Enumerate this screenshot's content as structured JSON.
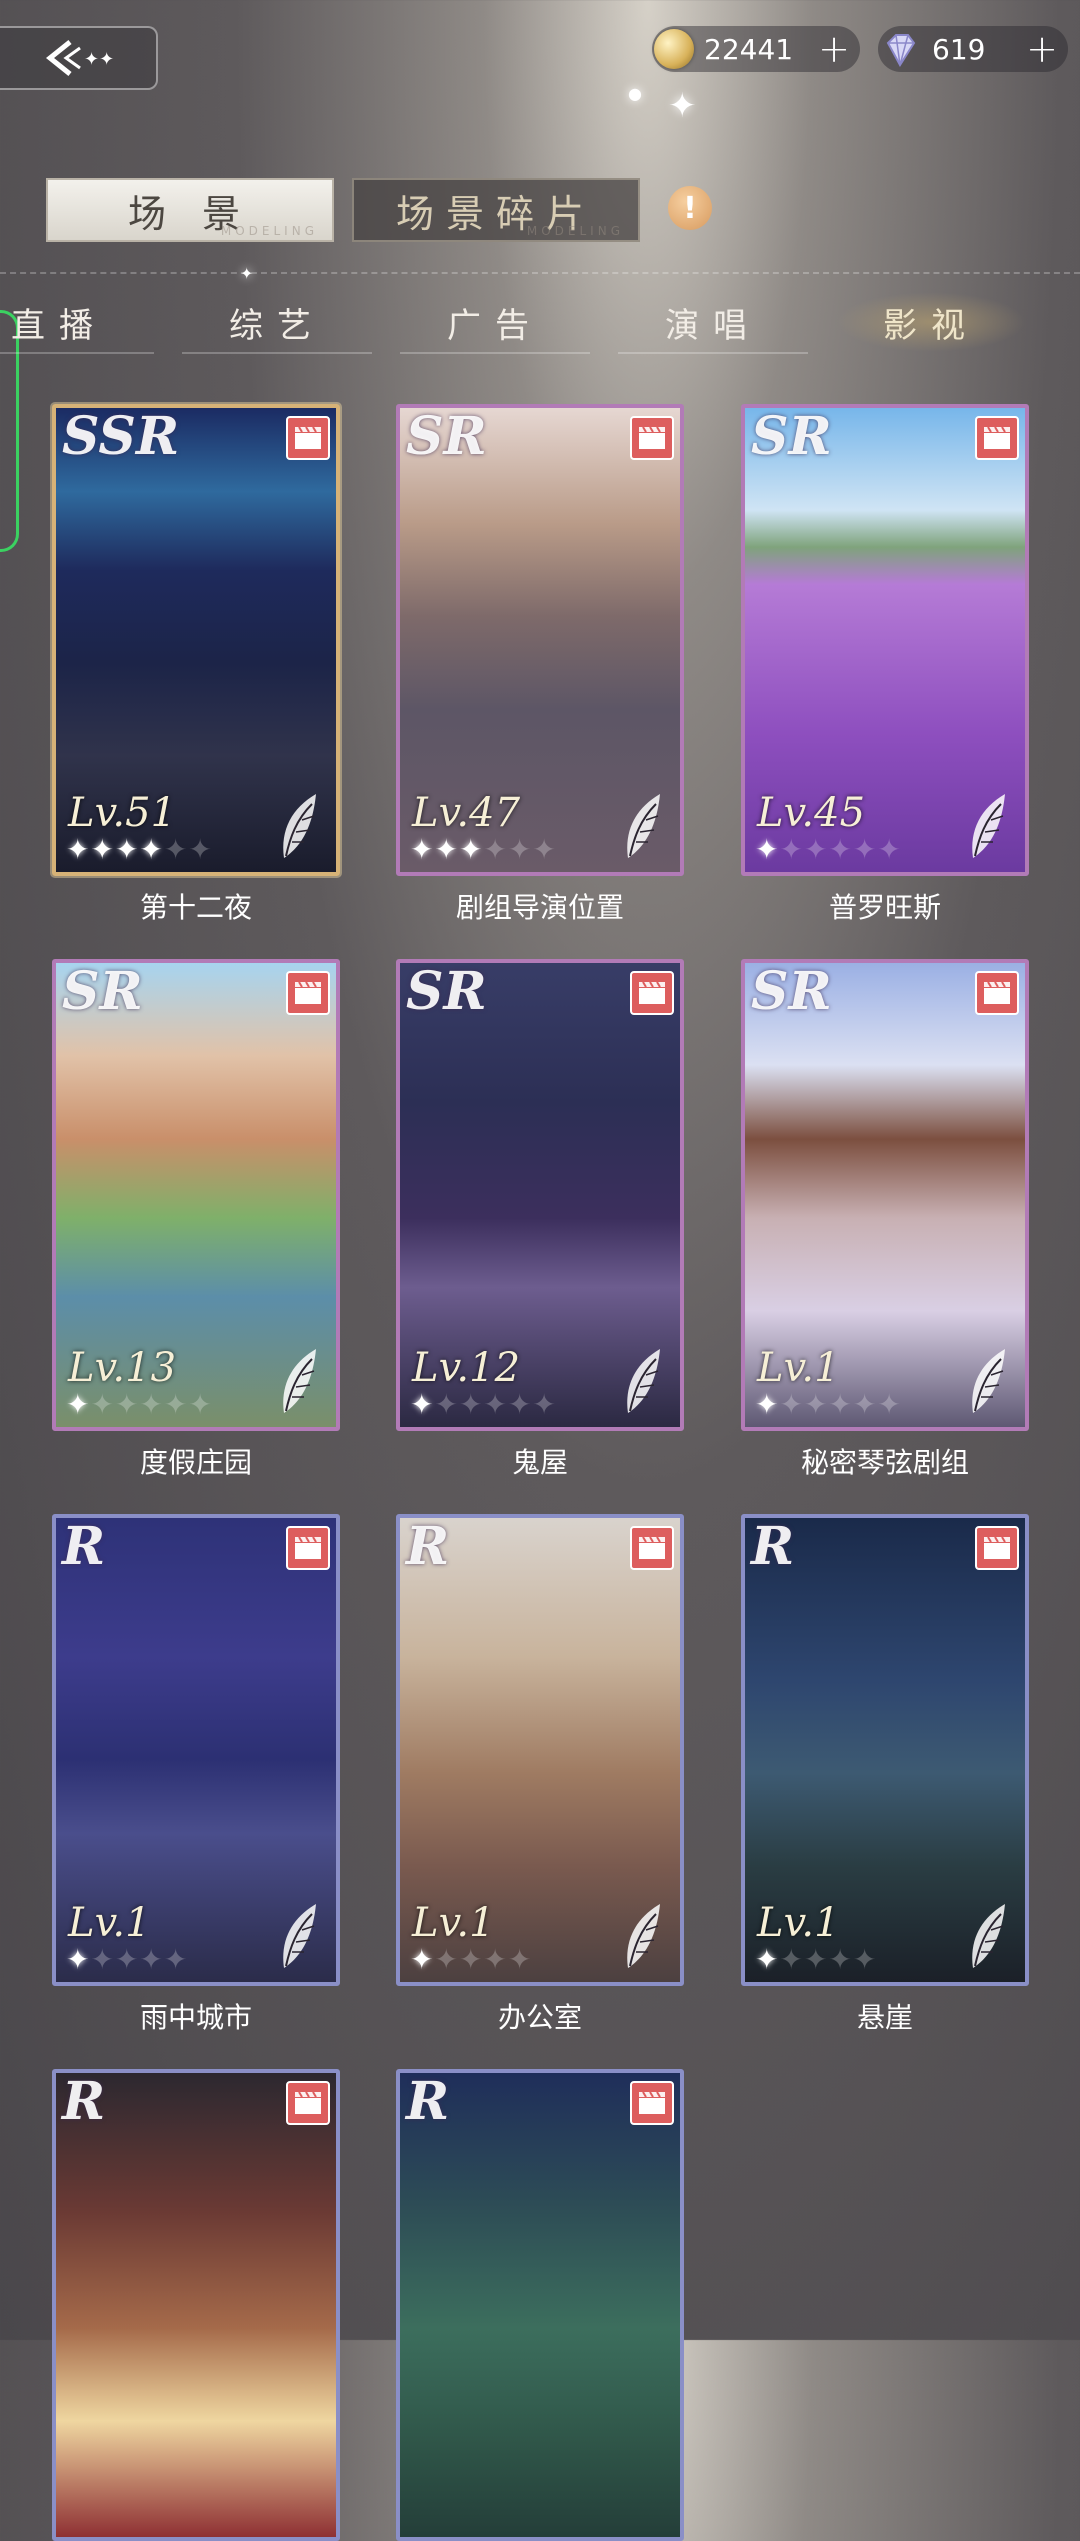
{
  "top_bar": {
    "coins": "22441",
    "gems": "619",
    "plus": "+"
  },
  "mode_tabs": [
    {
      "label": "场 景",
      "sub": "MODELING",
      "active": true
    },
    {
      "label": "场景碎片",
      "sub": "MODELING",
      "active": false
    }
  ],
  "info_badge": "!",
  "categories": [
    {
      "label": "直播",
      "active": false
    },
    {
      "label": "综艺",
      "active": false
    },
    {
      "label": "广告",
      "active": false
    },
    {
      "label": "演唱",
      "active": false
    },
    {
      "label": "影视",
      "active": true
    }
  ],
  "cards": [
    {
      "name": "第十二夜",
      "rarity": "SSR",
      "level": "Lv.51",
      "stars_on": 4,
      "stars_total": 6
    },
    {
      "name": "剧组导演位置",
      "rarity": "SR",
      "level": "Lv.47",
      "stars_on": 3,
      "stars_total": 6
    },
    {
      "name": "普罗旺斯",
      "rarity": "SR",
      "level": "Lv.45",
      "stars_on": 1,
      "stars_total": 6
    },
    {
      "name": "度假庄园",
      "rarity": "SR",
      "level": "Lv.13",
      "stars_on": 1,
      "stars_total": 6
    },
    {
      "name": "鬼屋",
      "rarity": "SR",
      "level": "Lv.12",
      "stars_on": 1,
      "stars_total": 6
    },
    {
      "name": "秘密琴弦剧组",
      "rarity": "SR",
      "level": "Lv.1",
      "stars_on": 1,
      "stars_total": 6
    },
    {
      "name": "雨中城市",
      "rarity": "R",
      "level": "Lv.1",
      "stars_on": 1,
      "stars_total": 5
    },
    {
      "name": "办公室",
      "rarity": "R",
      "level": "Lv.1",
      "stars_on": 1,
      "stars_total": 5
    },
    {
      "name": "悬崖",
      "rarity": "R",
      "level": "Lv.1",
      "stars_on": 1,
      "stars_total": 5
    },
    {
      "name": "",
      "rarity": "R",
      "level": "",
      "stars_on": 0,
      "stars_total": 0
    },
    {
      "name": "",
      "rarity": "R",
      "level": "",
      "stars_on": 0,
      "stars_total": 0
    }
  ],
  "colors": {
    "ssr_border": "#d6b277",
    "sr_border": "#b27bb7",
    "r_border": "#8a8fc7",
    "film_badge": "#dd5e5e"
  }
}
